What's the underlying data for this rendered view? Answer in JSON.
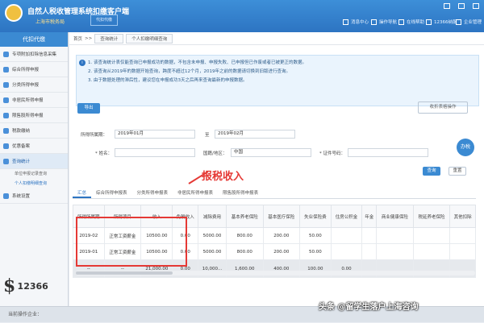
{
  "app": {
    "title": "自然人税收管理系统扣缴客户端",
    "subtitle": "上海市税务局",
    "user_tab": "代扣代缴"
  },
  "top_nav": [
    {
      "label": "消息中心"
    },
    {
      "label": "操作导航"
    },
    {
      "label": "在线帮助"
    },
    {
      "label": "12366纳服"
    },
    {
      "label": "企业管理"
    }
  ],
  "sidebar": {
    "header": "代扣代缴",
    "items": [
      {
        "label": "专项附加扣除信息采集"
      },
      {
        "label": "综合所得申报"
      },
      {
        "label": "分类所得申报"
      },
      {
        "label": "非居民所得申报"
      },
      {
        "label": "限售股所得申报"
      },
      {
        "label": "税款缴纳"
      },
      {
        "label": "优惠备案"
      },
      {
        "label": "查询统计"
      }
    ],
    "subitems": [
      {
        "label": "单位申报记录查询"
      },
      {
        "label": "个人扣缴明细查询"
      }
    ],
    "extra": {
      "label": "系统设置"
    },
    "hotline": "12366"
  },
  "breadcrumb": {
    "home": "首页",
    "sep": ">>",
    "tab1": "查询统计",
    "tab2": "个人扣缴明细查询"
  },
  "notice": {
    "line1": "1. 该查询统计表仅能查询已申报成功的数据，不包含未申报、申报失败、已申报但已作废或者已被更正的数据。",
    "line2": "2. 该查询从2019年的数据开始查询，跨度不超过12个月，2019年之前的数据请切换到旧版进行查询。",
    "line3": "3. 由于数据处理的滞后性，建议您在申报成功3天之后再来查询最新的申报数据。"
  },
  "buttons": {
    "export": "导出",
    "settings": "收折表格操作",
    "query": "查询",
    "reset": "重置"
  },
  "filters": {
    "period_label": "所得所属期：",
    "period_from": "2019年01月",
    "period_to_label": "至",
    "period_to": "2019年02月",
    "name_label": "* 姓名：",
    "nation_label": "国籍/地区：",
    "nation_value": "中国",
    "id_label": "* 证件号码："
  },
  "tabs": [
    {
      "label": "汇总"
    },
    {
      "label": "综合所得申报表"
    },
    {
      "label": "分类所得申报表"
    },
    {
      "label": "非居民所得申报表"
    },
    {
      "label": "限售股所得申报表"
    }
  ],
  "annotation": {
    "text": "报税收入"
  },
  "table": {
    "headers": [
      "所得所属期",
      "所得项目",
      "收入",
      "免税收入",
      "减除费用",
      "基本养老保险",
      "基本医疗保险",
      "失业保险费",
      "住房公积金",
      "年金",
      "商业健康保险",
      "税延养老保险",
      "其他扣除"
    ],
    "rows": [
      [
        "2019-02",
        "正常工资薪金",
        "10500.00",
        "0.00",
        "5000.00",
        "800.00",
        "200.00",
        "50.00",
        "",
        "",
        "",
        "",
        ""
      ],
      [
        "2019-01",
        "正常工资薪金",
        "10500.00",
        "0.00",
        "5000.00",
        "800.00",
        "200.00",
        "50.00",
        "",
        "",
        "",
        "",
        ""
      ]
    ],
    "total": [
      "--",
      "--",
      "21,000.00",
      "0.00",
      "10,000...",
      "1,600.00",
      "400.00",
      "100.00",
      "0.00",
      "",
      "",
      "",
      ""
    ]
  },
  "footer": {
    "text": "当前操作企业："
  },
  "help": {
    "label": "办税"
  },
  "watermark": "头条 @留学生落户上海咨询",
  "colors": {
    "accent": "#2d74c2",
    "annotation": "#e53935"
  }
}
